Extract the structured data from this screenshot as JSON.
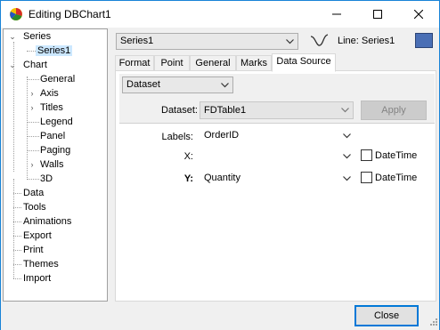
{
  "window": {
    "title": "Editing DBChart1"
  },
  "tree": {
    "items": [
      {
        "label": "Series",
        "expanded": true
      },
      {
        "label": "Series1",
        "selected": true
      },
      {
        "label": "Chart",
        "expanded": true
      },
      {
        "label": "General"
      },
      {
        "label": "Axis",
        "expandable": true
      },
      {
        "label": "Titles",
        "expandable": true
      },
      {
        "label": "Legend"
      },
      {
        "label": "Panel"
      },
      {
        "label": "Paging"
      },
      {
        "label": "Walls",
        "expandable": true
      },
      {
        "label": "3D"
      },
      {
        "label": "Data"
      },
      {
        "label": "Tools"
      },
      {
        "label": "Animations"
      },
      {
        "label": "Export"
      },
      {
        "label": "Print"
      },
      {
        "label": "Themes"
      },
      {
        "label": "Import"
      }
    ]
  },
  "series_selector": {
    "value": "Series1",
    "type_label": "Line: Series1",
    "color": "#4a6fb5",
    "icon": "line-series-icon"
  },
  "tabs": [
    {
      "label": "Format"
    },
    {
      "label": "Point"
    },
    {
      "label": "General"
    },
    {
      "label": "Marks"
    },
    {
      "label": "Data Source",
      "active": true
    }
  ],
  "datasource": {
    "source_type": "Dataset",
    "dataset_label": "Dataset:",
    "dataset_value": "FDTable1",
    "apply_label": "Apply",
    "labels_label": "Labels:",
    "labels_value": "OrderID",
    "x_label": "X:",
    "x_value": "",
    "y_label": "Y:",
    "y_value": "Quantity",
    "x_datetime_label": "DateTime",
    "y_datetime_label": "DateTime",
    "x_datetime_checked": false,
    "y_datetime_checked": false
  },
  "footer": {
    "close_label": "Close"
  }
}
